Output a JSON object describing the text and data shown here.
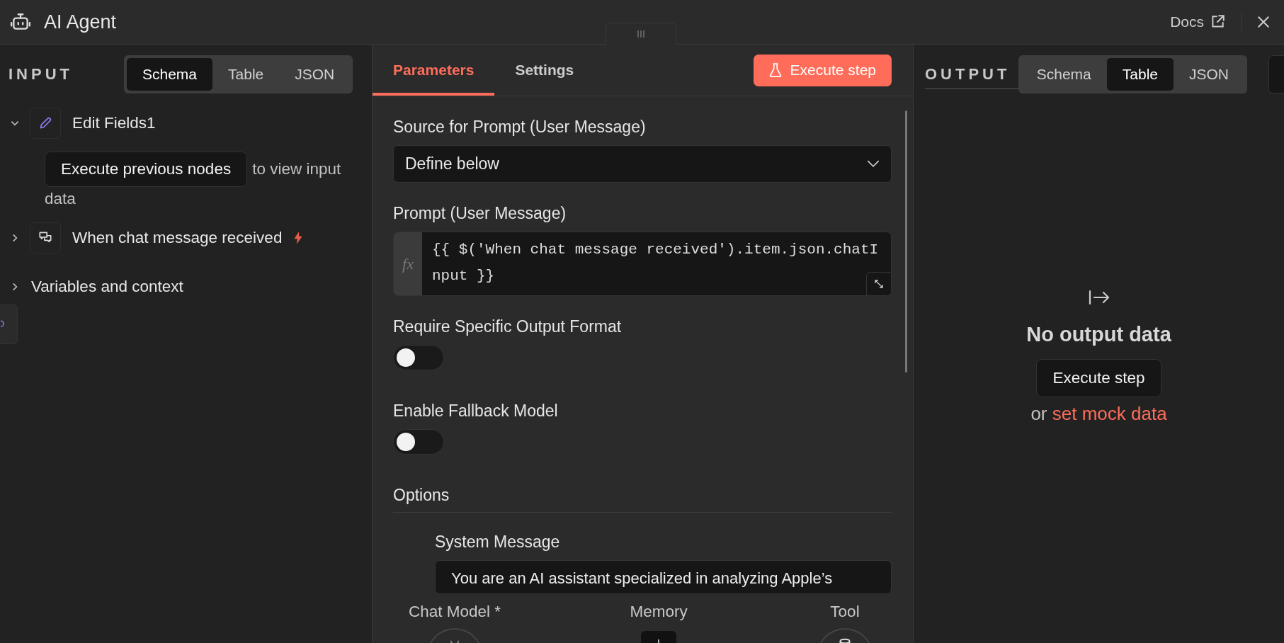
{
  "header": {
    "title": "AI Agent",
    "docs": "Docs"
  },
  "input_panel": {
    "heading": "INPUT",
    "tabs": [
      {
        "label": "Schema",
        "selected": true
      },
      {
        "label": "Table",
        "selected": false
      },
      {
        "label": "JSON",
        "selected": false
      }
    ],
    "nodes": [
      {
        "kind": "edit",
        "label": "Edit Fields1",
        "expanded": true,
        "trigger": false,
        "action": "Execute previous nodes",
        "hint": "to view input",
        "hint_2": "data"
      },
      {
        "kind": "chat",
        "label": "When chat message received",
        "expanded": false,
        "trigger": true
      }
    ],
    "variables": {
      "label": "Variables and context",
      "expanded": false
    }
  },
  "parameters_panel": {
    "tabs": [
      {
        "label": "Parameters",
        "selected": true
      },
      {
        "label": "Settings",
        "selected": false
      }
    ],
    "execute_button": "Execute step",
    "fields": [
      {
        "kind": "select",
        "label": "Source for Prompt (User Message)",
        "value": "Define below"
      },
      {
        "kind": "expression",
        "label": "Prompt (User Message)",
        "prefix": "fx",
        "value": "{{ $('When chat message received').item.json.chatInput }}"
      },
      {
        "kind": "toggle",
        "label": "Require Specific Output Format",
        "on": false
      },
      {
        "kind": "toggle",
        "label": "Enable Fallback Model",
        "on": false
      }
    ],
    "options": {
      "heading": "Options",
      "fields": [
        {
          "label": "System Message",
          "value": "You are an AI assistant specialized in analyzing Apple’s"
        }
      ]
    },
    "connectors": [
      {
        "kind": "model",
        "label": "Chat Model *"
      },
      {
        "kind": "memory",
        "label": "Memory"
      },
      {
        "kind": "tool",
        "label": "Tool"
      }
    ]
  },
  "output_panel": {
    "heading": "OUTPUT",
    "tabs": [
      {
        "label": "Schema",
        "selected": false
      },
      {
        "label": "Table",
        "selected": true
      },
      {
        "label": "JSON",
        "selected": false
      }
    ],
    "empty": {
      "title": "No output data",
      "button": "Execute step",
      "prefix": "or",
      "link": "set mock data"
    }
  }
}
